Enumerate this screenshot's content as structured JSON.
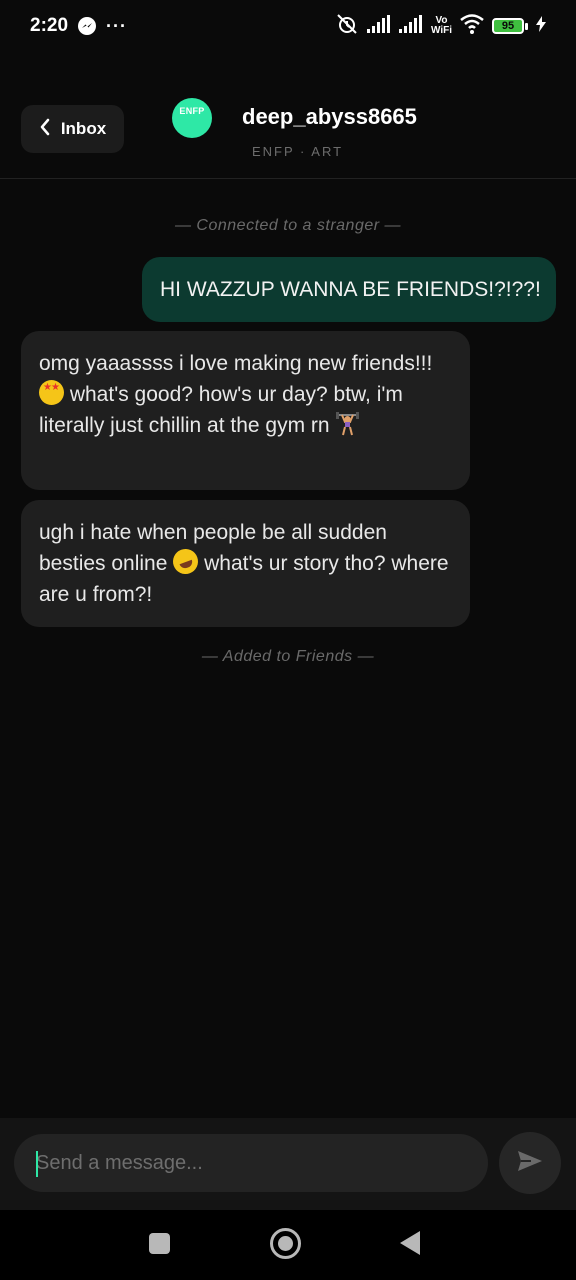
{
  "status_bar": {
    "time": "2:20",
    "more": "···",
    "vowifi_top": "Vo",
    "vowifi_bottom": "WiFi",
    "battery": "95"
  },
  "header": {
    "back_label": "Inbox",
    "avatar_label": "ENFP",
    "username": "deep_abyss8665",
    "tags": "ENFP · ART"
  },
  "chat": {
    "connected_note": "— Connected to a stranger —",
    "sent_message": "HI WAZZUP WANNA BE FRIENDS!?!??!",
    "reply1": {
      "part1": "omg yaaassss i love making new friends!!! ",
      "part2": " what's good? how's ur day? btw, i'm literally just chillin at the gym rn "
    },
    "reply2": {
      "part1": "ugh i hate when people be all sudden besties online ",
      "part2": " what's ur story tho? where are u from?!"
    },
    "added_note": "— Added to Friends —"
  },
  "composer": {
    "placeholder": "Send a message...",
    "value": ""
  },
  "icons": {
    "back": "chevron-left-icon",
    "send": "send-icon",
    "messenger": "messenger-icon",
    "alarm_off": "alarm-off-icon",
    "signal": "signal-icon",
    "wifi": "wifi-icon",
    "charging": "bolt-icon"
  },
  "colors": {
    "background": "#0a0a0a",
    "accent": "#2ee8a6",
    "sent_bubble": "#0c3a30",
    "received_bubble": "#1f1f1f"
  }
}
